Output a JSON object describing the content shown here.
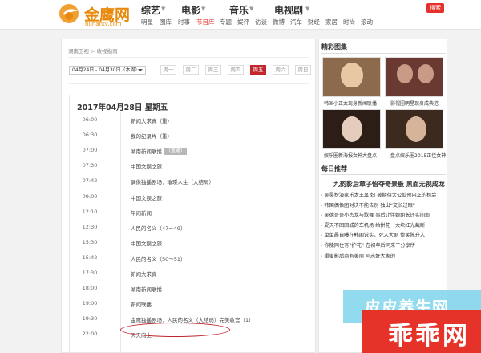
{
  "header": {
    "logo_text": "金鹰网",
    "logo_sub": "hunantv.com",
    "nav_top": [
      "综艺",
      "电影",
      "音乐",
      "电视剧"
    ],
    "nav_bottom": [
      "明星",
      "图库",
      "时事",
      "节目库",
      "专题",
      "娱评",
      "访谈",
      "微博",
      "汽车",
      "财经",
      "家居",
      "时尚",
      "滚动"
    ],
    "search_label": "搜索"
  },
  "breadcrumb": "湖南卫视 > 收视指南",
  "date_range": "04月24日 - 04月30日（本周）",
  "weekdays": [
    {
      "label": "周一",
      "active": false
    },
    {
      "label": "周二",
      "active": false
    },
    {
      "label": "周三",
      "active": false
    },
    {
      "label": "周四",
      "active": false
    },
    {
      "label": "周五",
      "active": true
    },
    {
      "label": "周六",
      "active": false
    },
    {
      "label": "周日",
      "active": false
    }
  ],
  "schedule": {
    "date_heading": "2017年04月28日 星期五",
    "programs": [
      {
        "time": "06:00",
        "title": "新闻大求真（重）",
        "tag": ""
      },
      {
        "time": "06:30",
        "title": "我的纪录片（重）",
        "tag": ""
      },
      {
        "time": "07:00",
        "title": "湖南新闻联播",
        "tag": "（重播）"
      },
      {
        "time": "07:30",
        "title": "中国文娱之旅",
        "tag": ""
      },
      {
        "time": "07:42",
        "title": "偶像独播剧场：璀璨人生（大结局）",
        "tag": ""
      },
      {
        "time": "09:00",
        "title": "中国文娱之旅",
        "tag": ""
      },
      {
        "time": "12:10",
        "title": "午间新闻",
        "tag": ""
      },
      {
        "time": "12:30",
        "title": "人民的名义（47～49）",
        "tag": ""
      },
      {
        "time": "15:30",
        "title": "中国文娱之旅",
        "tag": ""
      },
      {
        "time": "15:42",
        "title": "人民的名义（50～51）",
        "tag": ""
      },
      {
        "time": "17:30",
        "title": "新闻大求真",
        "tag": ""
      },
      {
        "time": "18:00",
        "title": "湖南新闻联播",
        "tag": ""
      },
      {
        "time": "19:00",
        "title": "新闻联播",
        "tag": ""
      },
      {
        "time": "19:30",
        "title": "金鹰独播剧场：人民的名义（大结局）完美收官（1）",
        "tag": ""
      },
      {
        "time": "22:00",
        "title": "天天向上",
        "tag": ""
      }
    ]
  },
  "sidebar": {
    "gallery_title": "精彩图集",
    "photos": [
      {
        "caption": "韩国小正太现身新闻联播",
        "colors": [
          "#8d6a4c",
          "#e7c7a4"
        ]
      },
      {
        "caption": "影视圈明星现身成典范",
        "colors": [
          "#6a3a32",
          "#c99b86"
        ]
      },
      {
        "caption": "娱乐圈新海报女神大盘点",
        "colors": [
          "#2c1d17",
          "#e4cdbc"
        ]
      },
      {
        "caption": "盘点娱乐圈2015正佳女神",
        "colors": [
          "#3d2a1f",
          "#d6b49a"
        ]
      }
    ],
    "news_title": "每日推荐",
    "headline": "九韵影后章子怡夺奇景板 黑面无视成龙",
    "news": [
      "吴昊扮演家乐太王显 妇 被期待大公仙预内正的机会",
      "韩国偶像团对决不能告别 独出“交长过眼”",
      "吴德哥哥小杰龙与歌舞 事后让伴娘组长还实间郎",
      "夏天不回回城的车机场 给拼花一大块红光截断",
      "单单晨自曝在韩国说实，死人大剧 惨笑陈升人",
      "你能同住有”护花“ 在初年后同来干分享所",
      "闺蜜影后商有美丽 阿志好大家的"
    ]
  },
  "watermark": {
    "blue_text": "皮皮养生网",
    "red_text": "乖乖网"
  }
}
